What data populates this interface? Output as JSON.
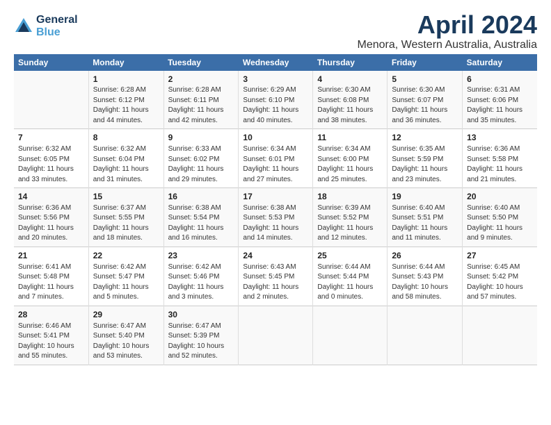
{
  "header": {
    "logo_line1": "General",
    "logo_line2": "Blue",
    "title": "April 2024",
    "subtitle": "Menora, Western Australia, Australia"
  },
  "days_of_week": [
    "Sunday",
    "Monday",
    "Tuesday",
    "Wednesday",
    "Thursday",
    "Friday",
    "Saturday"
  ],
  "weeks": [
    [
      {
        "day": "",
        "content": ""
      },
      {
        "day": "1",
        "content": "Sunrise: 6:28 AM\nSunset: 6:12 PM\nDaylight: 11 hours\nand 44 minutes."
      },
      {
        "day": "2",
        "content": "Sunrise: 6:28 AM\nSunset: 6:11 PM\nDaylight: 11 hours\nand 42 minutes."
      },
      {
        "day": "3",
        "content": "Sunrise: 6:29 AM\nSunset: 6:10 PM\nDaylight: 11 hours\nand 40 minutes."
      },
      {
        "day": "4",
        "content": "Sunrise: 6:30 AM\nSunset: 6:08 PM\nDaylight: 11 hours\nand 38 minutes."
      },
      {
        "day": "5",
        "content": "Sunrise: 6:30 AM\nSunset: 6:07 PM\nDaylight: 11 hours\nand 36 minutes."
      },
      {
        "day": "6",
        "content": "Sunrise: 6:31 AM\nSunset: 6:06 PM\nDaylight: 11 hours\nand 35 minutes."
      }
    ],
    [
      {
        "day": "7",
        "content": "Sunrise: 6:32 AM\nSunset: 6:05 PM\nDaylight: 11 hours\nand 33 minutes."
      },
      {
        "day": "8",
        "content": "Sunrise: 6:32 AM\nSunset: 6:04 PM\nDaylight: 11 hours\nand 31 minutes."
      },
      {
        "day": "9",
        "content": "Sunrise: 6:33 AM\nSunset: 6:02 PM\nDaylight: 11 hours\nand 29 minutes."
      },
      {
        "day": "10",
        "content": "Sunrise: 6:34 AM\nSunset: 6:01 PM\nDaylight: 11 hours\nand 27 minutes."
      },
      {
        "day": "11",
        "content": "Sunrise: 6:34 AM\nSunset: 6:00 PM\nDaylight: 11 hours\nand 25 minutes."
      },
      {
        "day": "12",
        "content": "Sunrise: 6:35 AM\nSunset: 5:59 PM\nDaylight: 11 hours\nand 23 minutes."
      },
      {
        "day": "13",
        "content": "Sunrise: 6:36 AM\nSunset: 5:58 PM\nDaylight: 11 hours\nand 21 minutes."
      }
    ],
    [
      {
        "day": "14",
        "content": "Sunrise: 6:36 AM\nSunset: 5:56 PM\nDaylight: 11 hours\nand 20 minutes."
      },
      {
        "day": "15",
        "content": "Sunrise: 6:37 AM\nSunset: 5:55 PM\nDaylight: 11 hours\nand 18 minutes."
      },
      {
        "day": "16",
        "content": "Sunrise: 6:38 AM\nSunset: 5:54 PM\nDaylight: 11 hours\nand 16 minutes."
      },
      {
        "day": "17",
        "content": "Sunrise: 6:38 AM\nSunset: 5:53 PM\nDaylight: 11 hours\nand 14 minutes."
      },
      {
        "day": "18",
        "content": "Sunrise: 6:39 AM\nSunset: 5:52 PM\nDaylight: 11 hours\nand 12 minutes."
      },
      {
        "day": "19",
        "content": "Sunrise: 6:40 AM\nSunset: 5:51 PM\nDaylight: 11 hours\nand 11 minutes."
      },
      {
        "day": "20",
        "content": "Sunrise: 6:40 AM\nSunset: 5:50 PM\nDaylight: 11 hours\nand 9 minutes."
      }
    ],
    [
      {
        "day": "21",
        "content": "Sunrise: 6:41 AM\nSunset: 5:48 PM\nDaylight: 11 hours\nand 7 minutes."
      },
      {
        "day": "22",
        "content": "Sunrise: 6:42 AM\nSunset: 5:47 PM\nDaylight: 11 hours\nand 5 minutes."
      },
      {
        "day": "23",
        "content": "Sunrise: 6:42 AM\nSunset: 5:46 PM\nDaylight: 11 hours\nand 3 minutes."
      },
      {
        "day": "24",
        "content": "Sunrise: 6:43 AM\nSunset: 5:45 PM\nDaylight: 11 hours\nand 2 minutes."
      },
      {
        "day": "25",
        "content": "Sunrise: 6:44 AM\nSunset: 5:44 PM\nDaylight: 11 hours\nand 0 minutes."
      },
      {
        "day": "26",
        "content": "Sunrise: 6:44 AM\nSunset: 5:43 PM\nDaylight: 10 hours\nand 58 minutes."
      },
      {
        "day": "27",
        "content": "Sunrise: 6:45 AM\nSunset: 5:42 PM\nDaylight: 10 hours\nand 57 minutes."
      }
    ],
    [
      {
        "day": "28",
        "content": "Sunrise: 6:46 AM\nSunset: 5:41 PM\nDaylight: 10 hours\nand 55 minutes."
      },
      {
        "day": "29",
        "content": "Sunrise: 6:47 AM\nSunset: 5:40 PM\nDaylight: 10 hours\nand 53 minutes."
      },
      {
        "day": "30",
        "content": "Sunrise: 6:47 AM\nSunset: 5:39 PM\nDaylight: 10 hours\nand 52 minutes."
      },
      {
        "day": "",
        "content": ""
      },
      {
        "day": "",
        "content": ""
      },
      {
        "day": "",
        "content": ""
      },
      {
        "day": "",
        "content": ""
      }
    ]
  ]
}
